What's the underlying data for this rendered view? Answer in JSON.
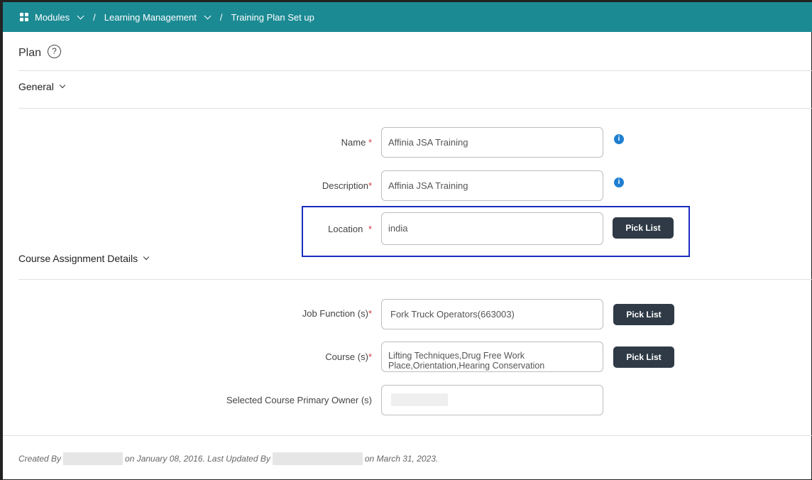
{
  "breadcrumb": {
    "modules": "Modules",
    "separator": "/",
    "learning_management": "Learning Management",
    "current": "Training Plan Set up"
  },
  "page": {
    "title": "Plan",
    "help_glyph": "?"
  },
  "sections": {
    "general": "General",
    "course_assignment": "Course Assignment Details"
  },
  "form": {
    "name_label": "Name",
    "name_value": "Affinia JSA Training",
    "description_label": "Description",
    "description_value": "Affinia JSA Training",
    "location_label": "Location",
    "location_value": "india",
    "job_function_label": "Job Function (s)",
    "job_function_value": "Fork Truck Operators(663003)",
    "course_label": "Course (s)",
    "course_value": "Lifting Techniques,Drug Free Work Place,Orientation,Hearing Conservation",
    "primary_owner_label": "Selected Course Primary Owner (s)",
    "required_mark": "*",
    "info_glyph": "i"
  },
  "buttons": {
    "pick_list": "Pick List"
  },
  "footer": {
    "created_by": "Created By",
    "created_on": "on January 08, 2016. Last Updated By",
    "updated_on": "on March 31, 2023."
  },
  "colors": {
    "topbar": "#1b8a93",
    "button": "#2f3a46",
    "required": "#d43b3b",
    "info": "#1f7fd1",
    "highlight": "#1a2dbf"
  }
}
